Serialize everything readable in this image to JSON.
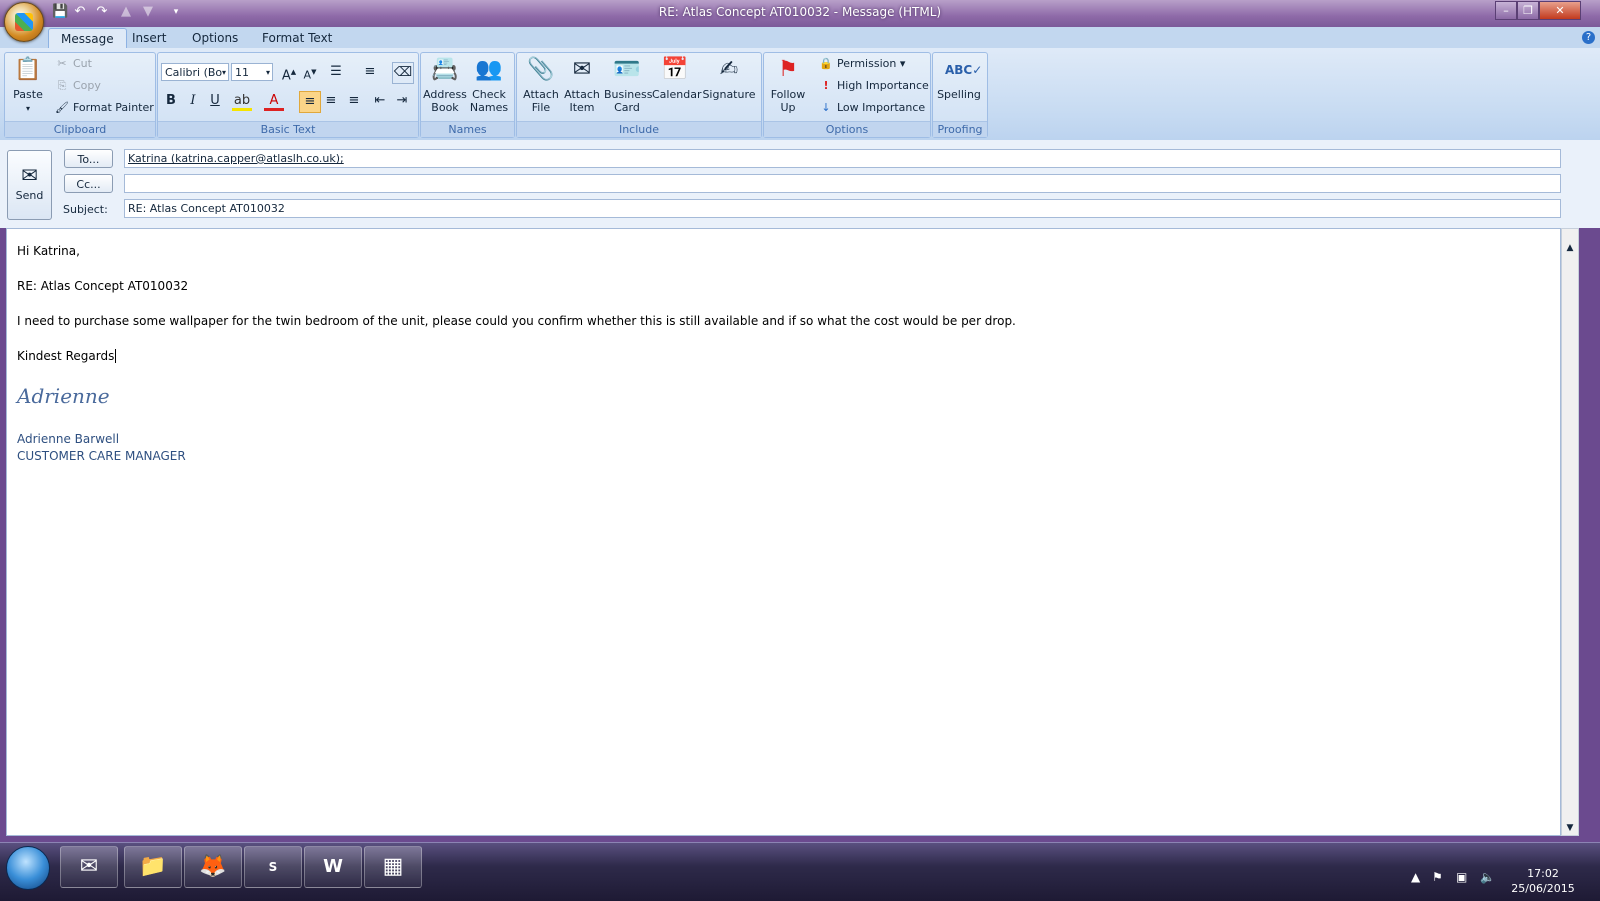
{
  "window": {
    "title": "RE: Atlas Concept AT010032  - Message (HTML)",
    "controls": [
      "–",
      "❐",
      "✕"
    ]
  },
  "ribbon": {
    "tabs": [
      "Message",
      "Insert",
      "Options",
      "Format Text"
    ],
    "active_tab": "Message",
    "clipboard": {
      "label": "Clipboard",
      "paste": "Paste",
      "cut": "Cut",
      "copy": "Copy",
      "format_painter": "Format Painter"
    },
    "basic_text": {
      "label": "Basic Text",
      "font_name": "Calibri (Bo",
      "font_size": "11"
    },
    "names": {
      "label": "Names",
      "address_book": "Address Book",
      "check_names": "Check Names"
    },
    "include": {
      "label": "Include",
      "attach_file": "Attach File",
      "attach_item": "Attach Item",
      "business_card": "Business Card",
      "calendar": "Calendar",
      "signature": "Signature"
    },
    "options": {
      "label": "Options",
      "follow_up": "Follow Up",
      "permission": "Permission",
      "high_importance": "High Importance",
      "low_importance": "Low Importance"
    },
    "proofing": {
      "label": "Proofing",
      "spelling": "Spelling"
    }
  },
  "header": {
    "send": "Send",
    "to_button": "To...",
    "cc_button": "Cc...",
    "subject_label": "Subject:",
    "to_value": "Katrina (katrina.capper@atlaslh.co.uk);",
    "cc_value": "",
    "subject_value": "RE: Atlas Concept AT010032"
  },
  "body": {
    "greeting": "Hi Katrina,",
    "ref": "RE: Atlas Concept AT010032",
    "message": "I need to purchase some wallpaper for the twin bedroom of the unit, please could you confirm whether this is still available and if so what the cost would be per drop.",
    "closing": "Kindest Regards",
    "signature_script": "Adrienne",
    "signature_name": "Adrienne Barwell",
    "signature_title": "CUSTOMER CARE MANAGER"
  },
  "taskbar": {
    "time": "17:02",
    "date": "25/06/2015",
    "apps": [
      "outlook-icon",
      "explorer-icon",
      "firefox-icon",
      "sage-icon",
      "word-icon",
      "app-icon"
    ]
  },
  "colors": {
    "ribbon_bg": "#c7dbf2",
    "signature_blue": "#4a6a9c",
    "title_purple": "#8e6aa8"
  }
}
